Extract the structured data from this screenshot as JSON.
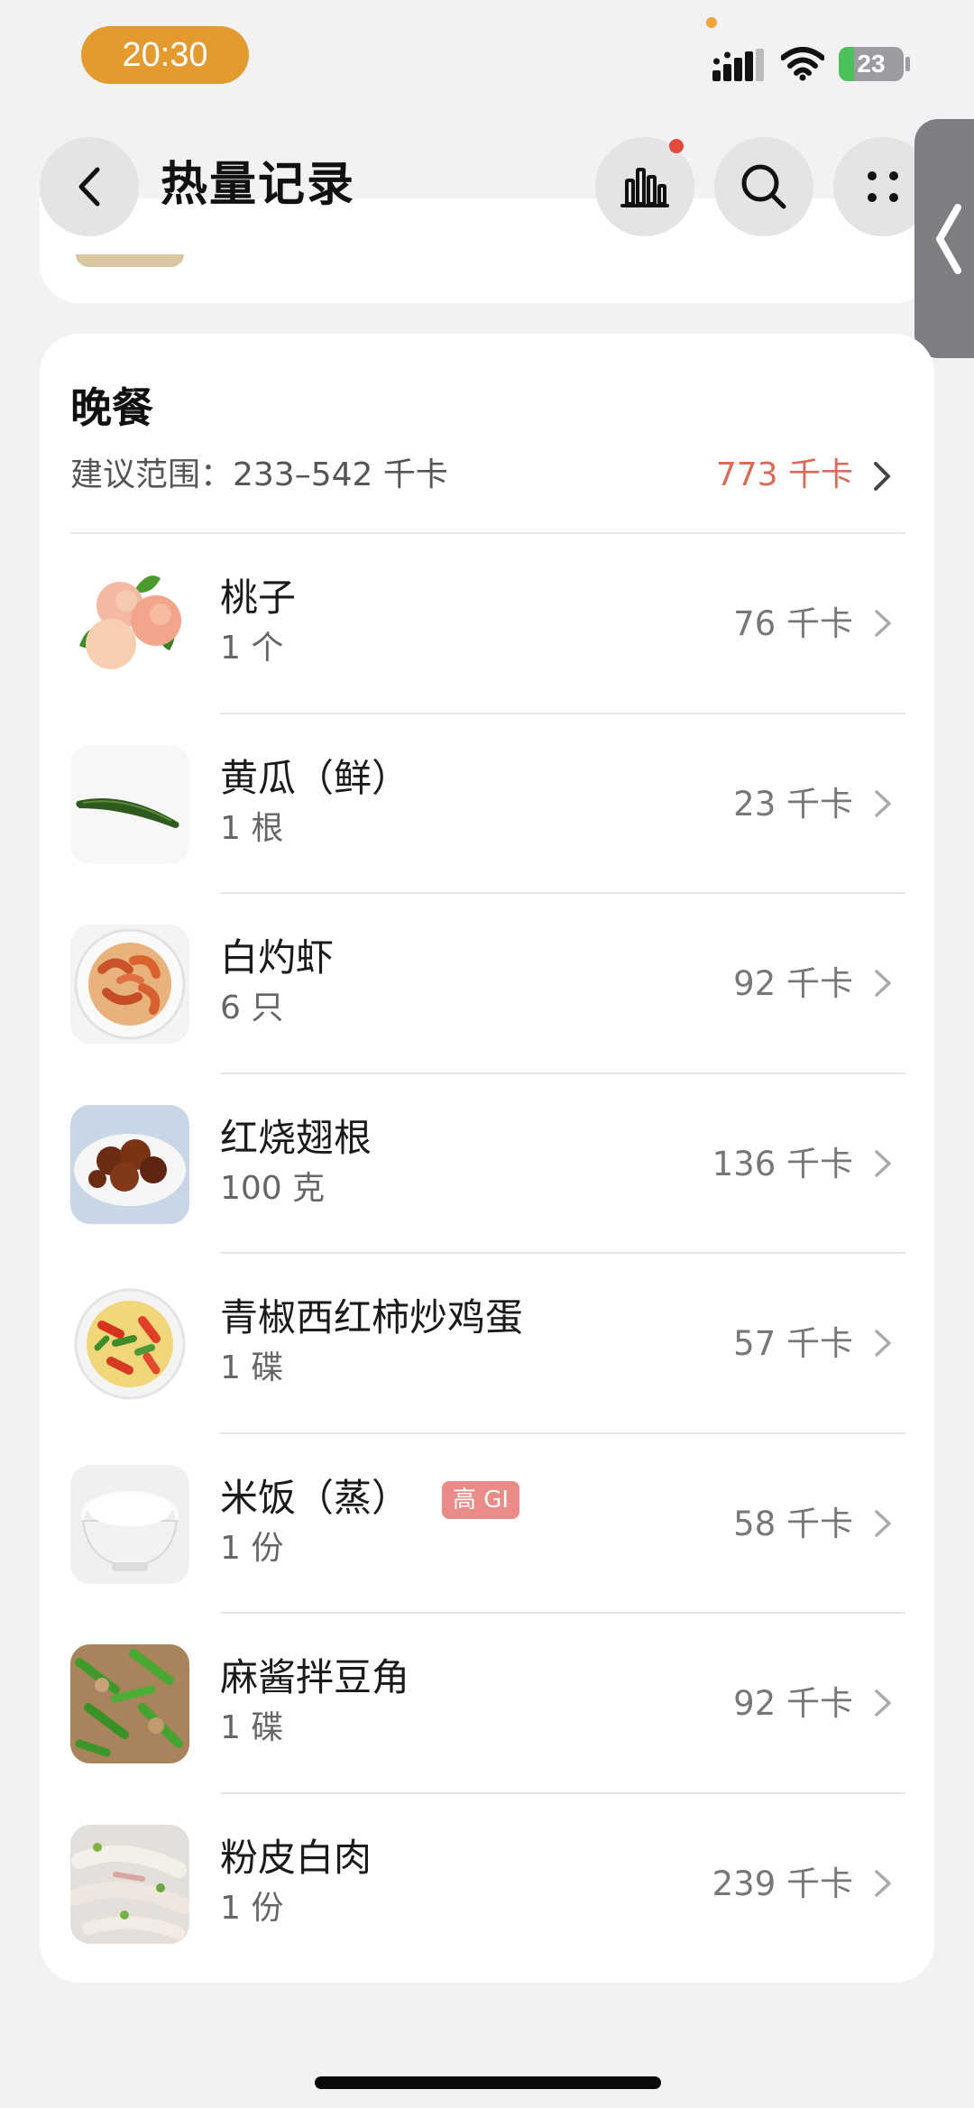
{
  "status_bar": {
    "time": "20:30",
    "battery_text": "23",
    "battery_level": 0.23
  },
  "header": {
    "title": "热量记录",
    "back_icon": "chevron-left-icon",
    "stats_icon": "bar-chart-icon",
    "search_icon": "search-icon",
    "more_icon": "more-dots-icon"
  },
  "meal": {
    "title": "晚餐",
    "range_label": "建议范围：233–542 千卡",
    "total": "773 千卡",
    "items": [
      {
        "name": "桃子",
        "qty": "1 个",
        "kcal": "76 千卡",
        "badge": ""
      },
      {
        "name": "黄瓜（鲜）",
        "qty": "1 根",
        "kcal": "23 千卡",
        "badge": ""
      },
      {
        "name": "白灼虾",
        "qty": "6 只",
        "kcal": "92 千卡",
        "badge": ""
      },
      {
        "name": "红烧翅根",
        "qty": "100 克",
        "kcal": "136 千卡",
        "badge": ""
      },
      {
        "name": "青椒西红柿炒鸡蛋",
        "qty": "1 碟",
        "kcal": "57 千卡",
        "badge": ""
      },
      {
        "name": "米饭（蒸）",
        "qty": "1 份",
        "kcal": "58 千卡",
        "badge": "高 GI"
      },
      {
        "name": "麻酱拌豆角",
        "qty": "1 碟",
        "kcal": "92 千卡",
        "badge": ""
      },
      {
        "name": "粉皮白肉",
        "qty": "1 份",
        "kcal": "239 千卡",
        "badge": ""
      }
    ]
  },
  "colors": {
    "accent_total": "#d96b57",
    "time_pill": "#e39a2f",
    "gi_badge": "#e98b86"
  }
}
